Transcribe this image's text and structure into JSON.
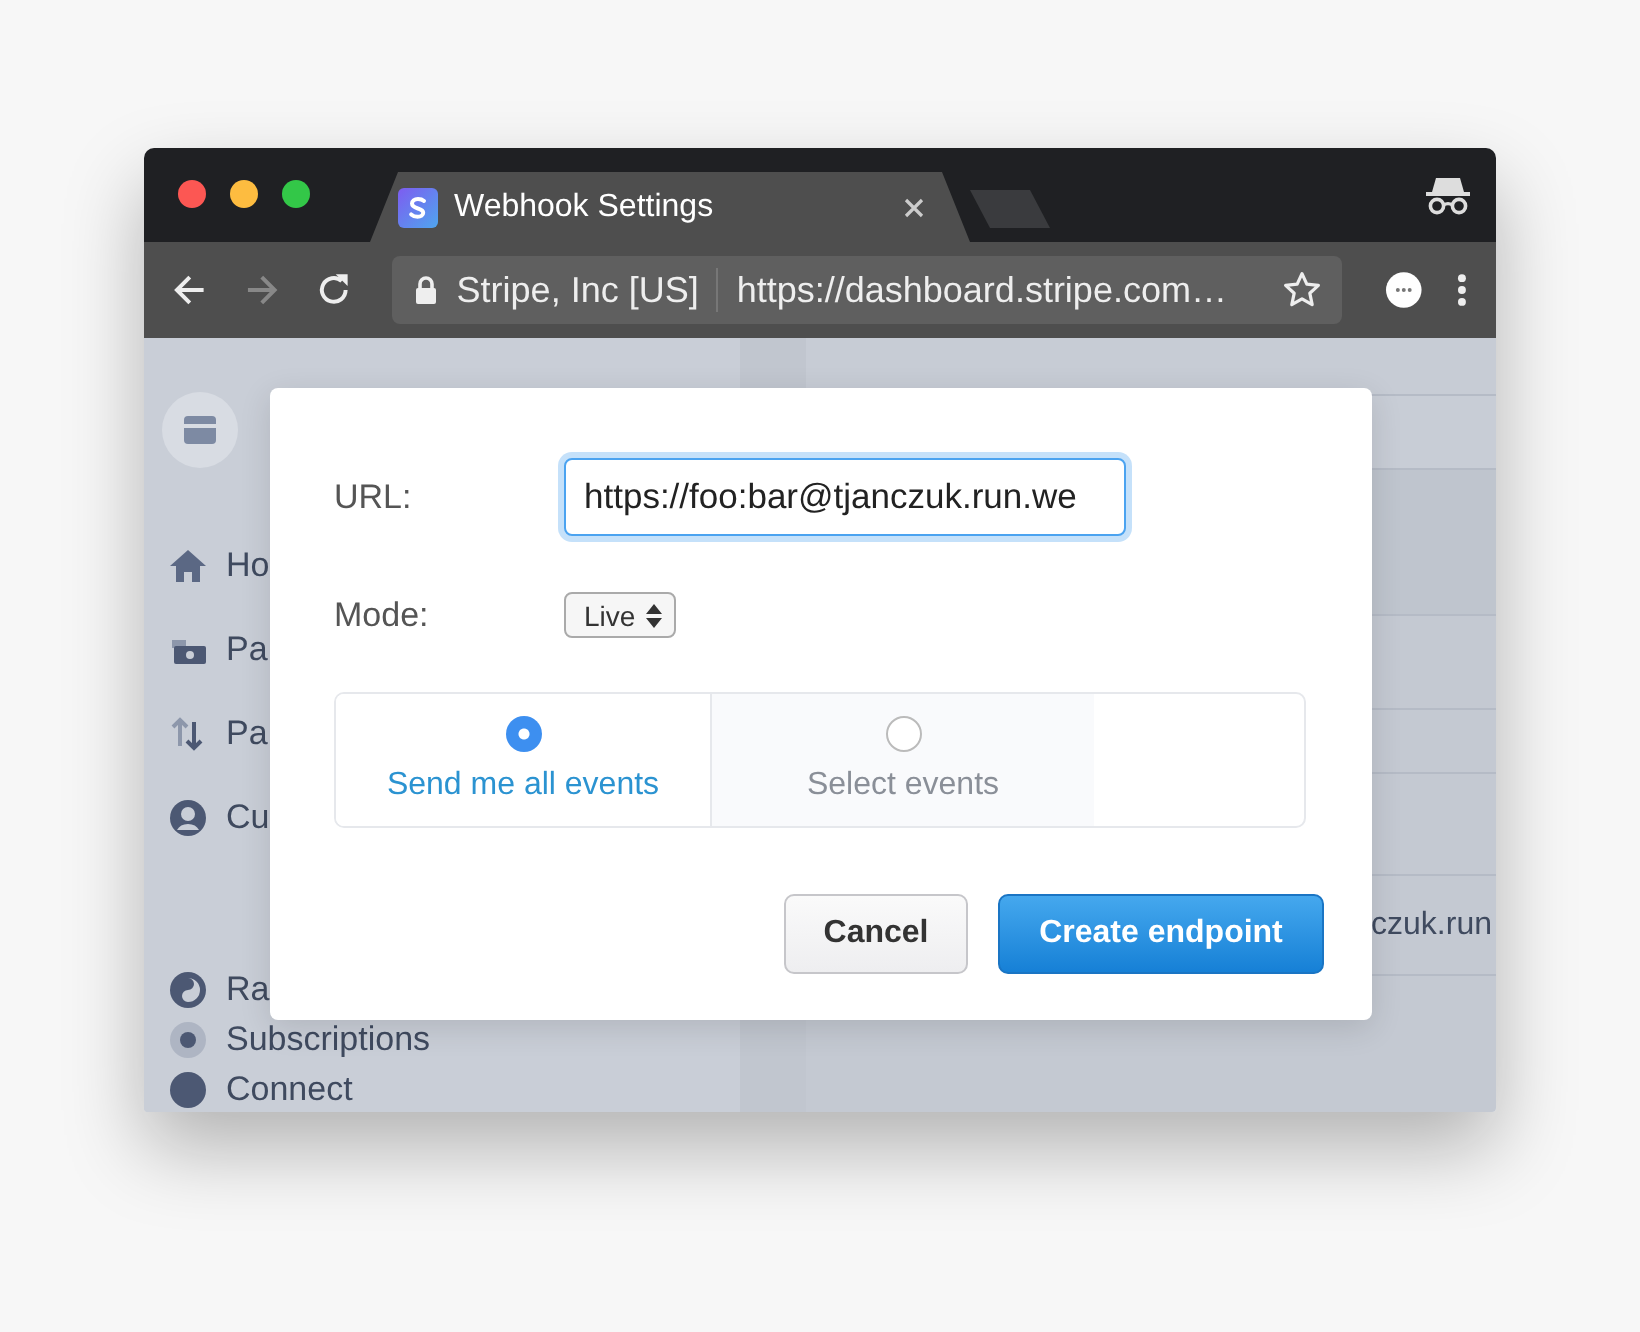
{
  "browser": {
    "tab": {
      "title": "Webhook Settings"
    },
    "toolbar": {
      "site_identity": "Stripe, Inc [US]",
      "address": "https://dashboard.stripe.com…"
    }
  },
  "sidebar": {
    "groups": [
      [
        {
          "label": "Ho"
        },
        {
          "label": "Pa"
        },
        {
          "label": "Pa"
        },
        {
          "label": "Cu"
        }
      ],
      [
        {
          "label": "Ra"
        },
        {
          "label": "Subscriptions"
        },
        {
          "label": "Connect"
        }
      ]
    ]
  },
  "background_table": {
    "cell": "czuk.run"
  },
  "dialog": {
    "url": {
      "label": "URL:",
      "value": "https://foo:bar@tjanczuk.run.we"
    },
    "mode": {
      "label": "Mode:",
      "value": "Live"
    },
    "event_options": [
      {
        "label": "Send me all events",
        "selected": true
      },
      {
        "label": "Select events",
        "selected": false
      }
    ],
    "buttons": [
      {
        "label": "Cancel",
        "kind": "secondary"
      },
      {
        "label": "Create endpoint",
        "kind": "primary"
      }
    ]
  }
}
